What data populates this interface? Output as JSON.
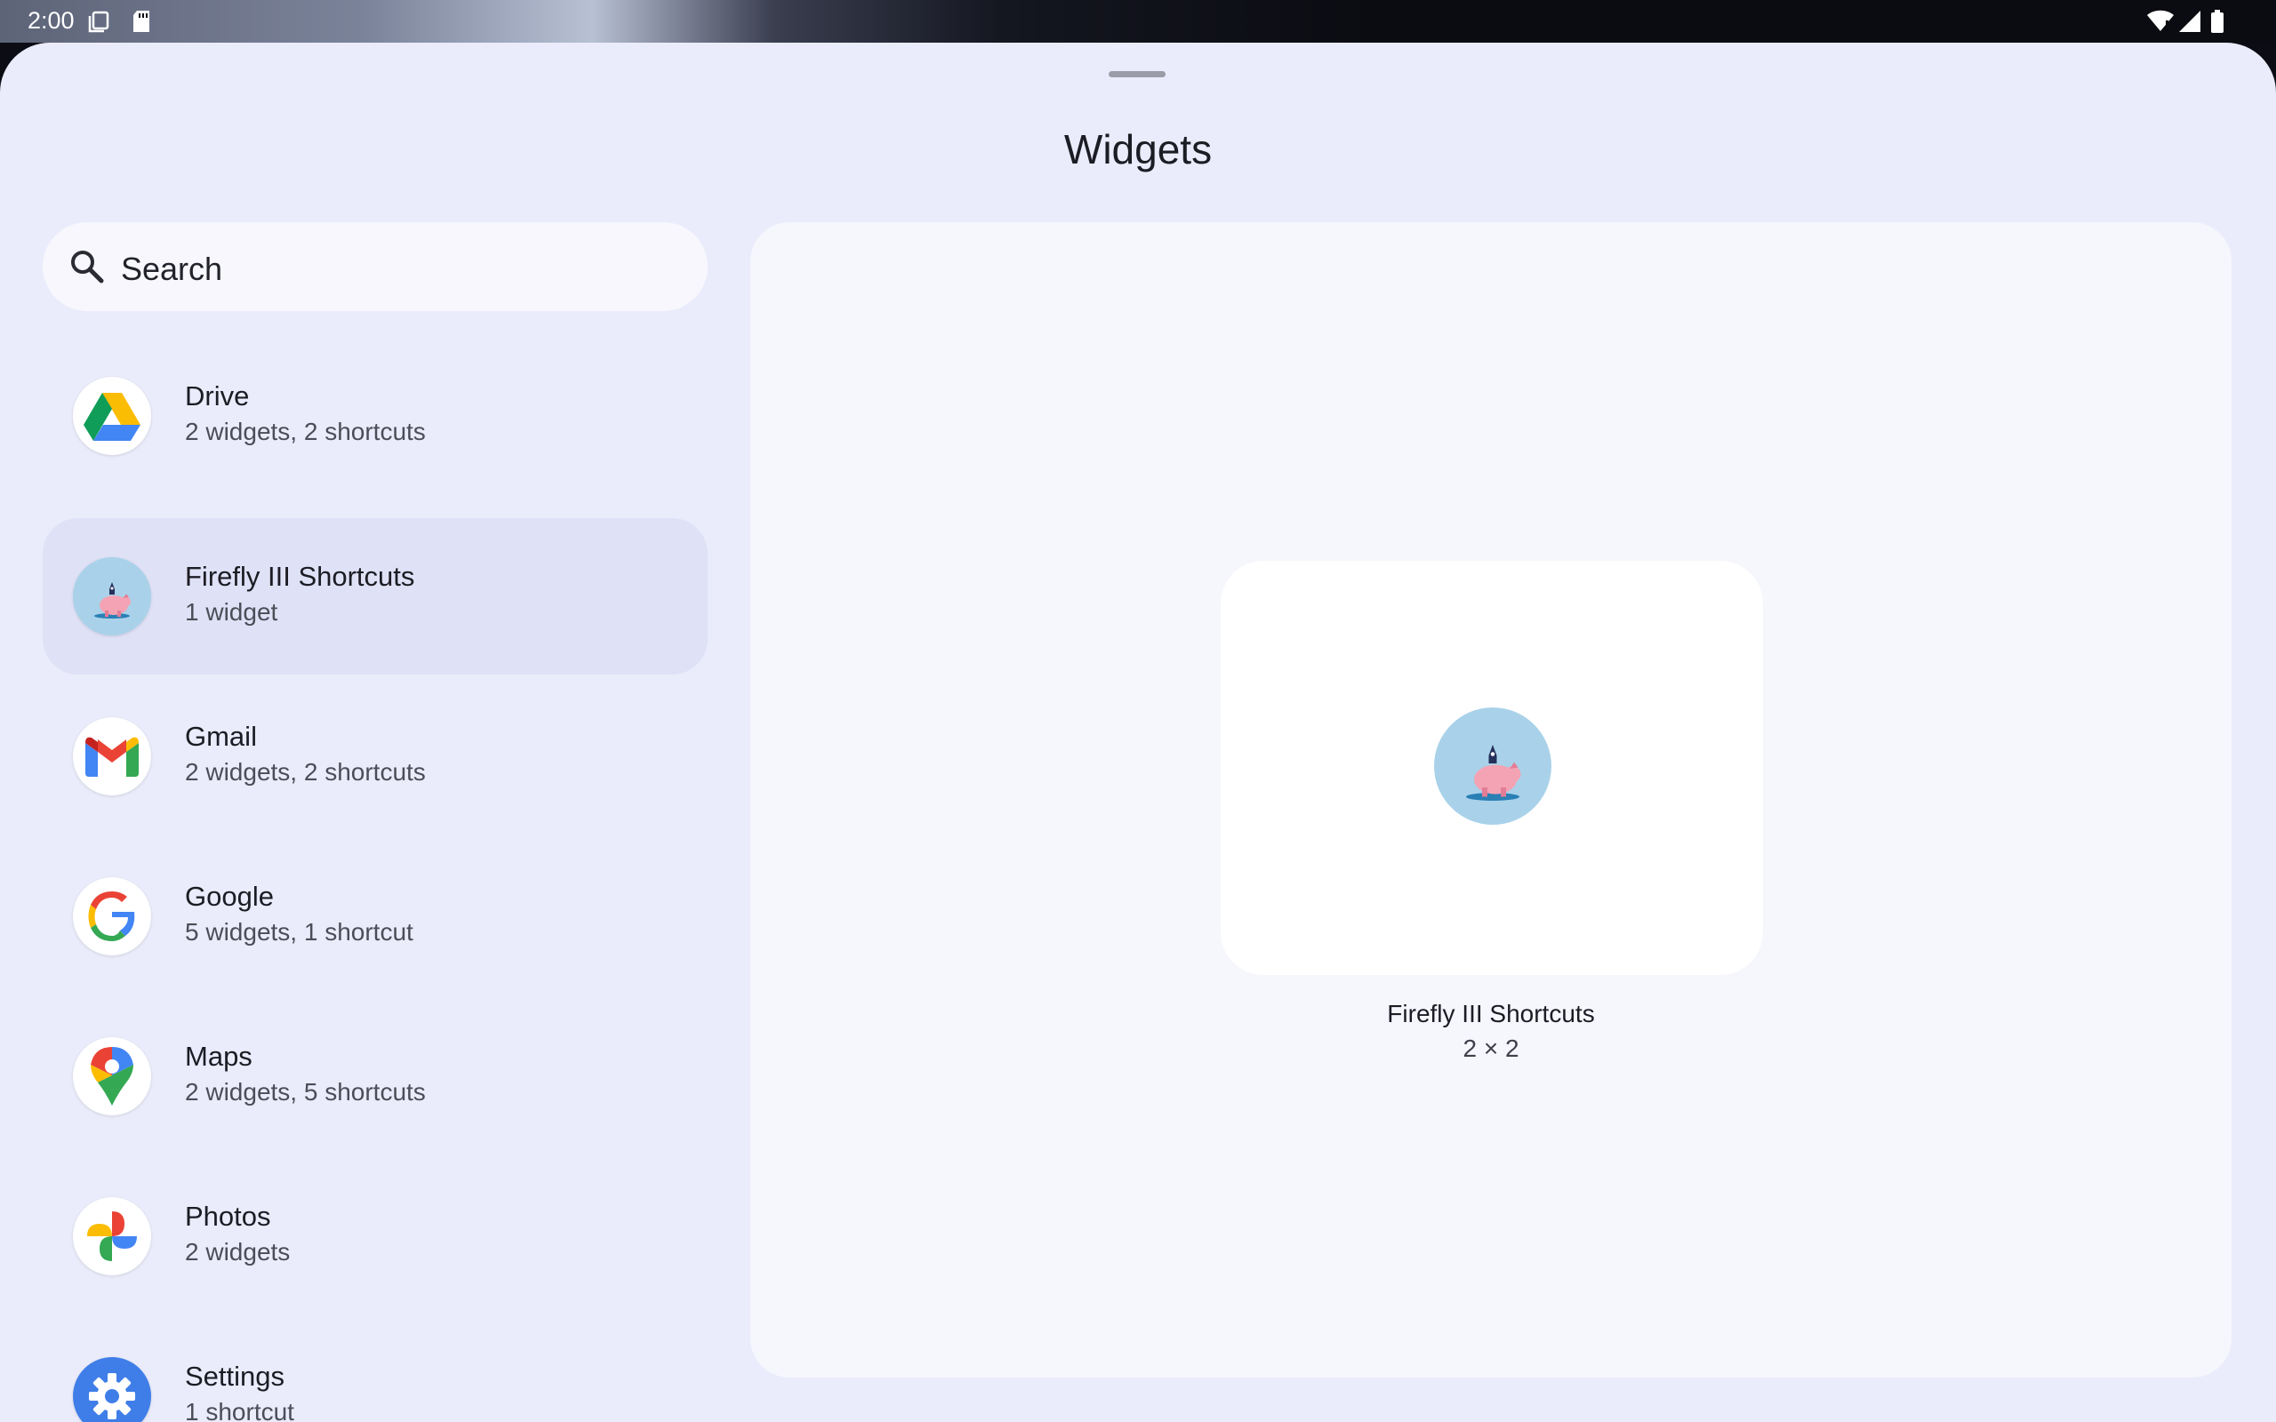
{
  "status_bar": {
    "time": "2:00",
    "left_icons": [
      "screenshot-icon",
      "sd-card-icon"
    ],
    "right_icons": [
      "wifi-icon",
      "signal-icon",
      "battery-icon"
    ]
  },
  "sheet": {
    "title": "Widgets"
  },
  "search": {
    "placeholder": "Search",
    "icon": "search-icon"
  },
  "apps": [
    {
      "name": "Drive",
      "subtitle": "2 widgets, 2 shortcuts",
      "icon": "drive-icon",
      "selected": false
    },
    {
      "name": "Firefly III Shortcuts",
      "subtitle": "1 widget",
      "icon": "firefly-piggy-icon",
      "selected": true
    },
    {
      "name": "Gmail",
      "subtitle": "2 widgets, 2 shortcuts",
      "icon": "gmail-icon",
      "selected": false
    },
    {
      "name": "Google",
      "subtitle": "5 widgets, 1 shortcut",
      "icon": "google-icon",
      "selected": false
    },
    {
      "name": "Maps",
      "subtitle": "2 widgets, 5 shortcuts",
      "icon": "maps-icon",
      "selected": false
    },
    {
      "name": "Photos",
      "subtitle": "2 widgets",
      "icon": "photos-icon",
      "selected": false
    },
    {
      "name": "Settings",
      "subtitle": "1 shortcut",
      "icon": "settings-icon",
      "selected": false
    }
  ],
  "preview": {
    "widget_name": "Firefly III Shortcuts",
    "widget_size": "2 × 2",
    "icon": "firefly-piggy-icon"
  },
  "colors": {
    "sheet_bg": "#eaecfb",
    "selected_item": "#dfe1f6",
    "panel_bg": "#f6f6fd",
    "firefly_icon_bg": "#a9d2ea"
  }
}
